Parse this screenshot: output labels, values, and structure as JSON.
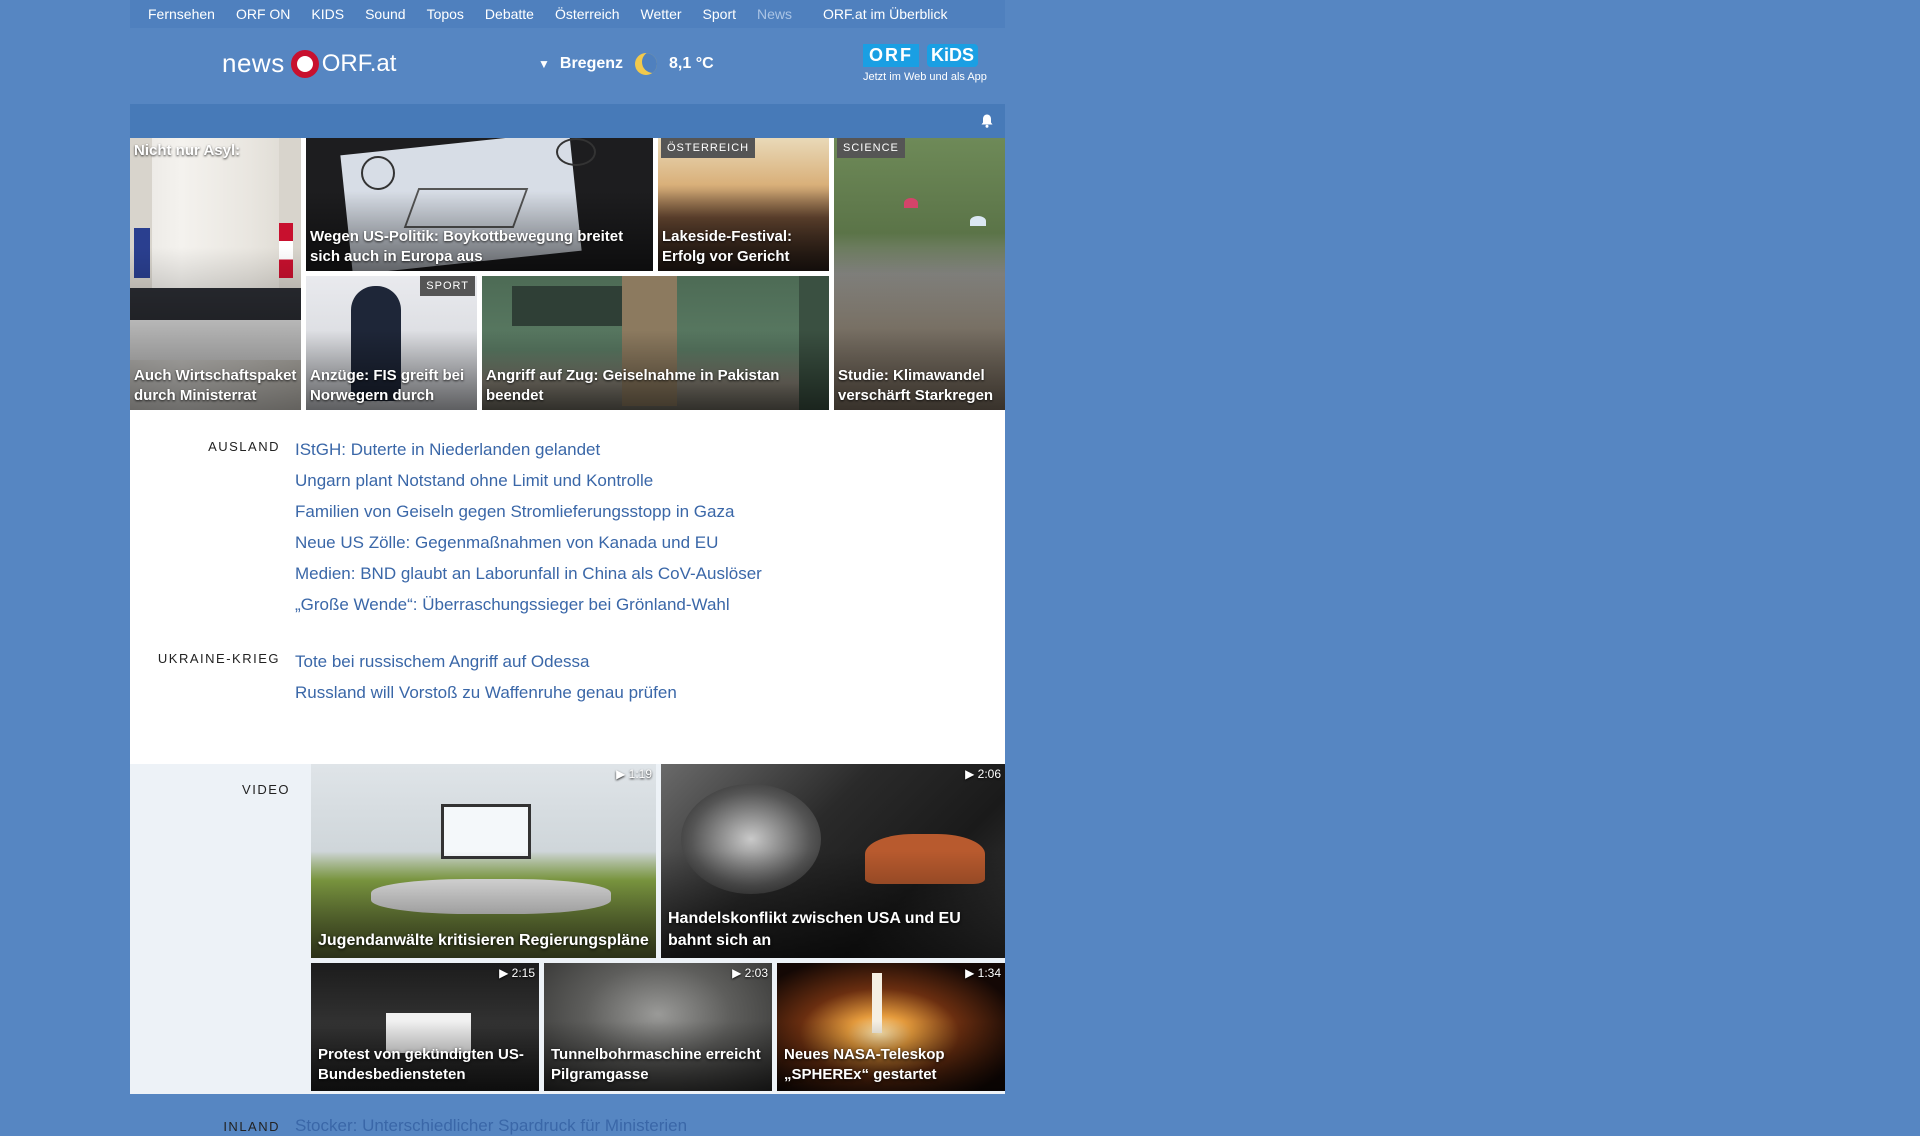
{
  "nav": {
    "items": [
      "Fernsehen",
      "ORF ON",
      "KIDS",
      "Sound",
      "Topos",
      "Debatte",
      "Österreich",
      "Wetter",
      "Sport",
      "News"
    ],
    "overview": "ORF.at im Überblick"
  },
  "header": {
    "logo_news": "news",
    "logo_orf": "ORF.at",
    "city": "Bregenz",
    "temp": "8,1 °C",
    "kids_orf": "ORF",
    "kids_kids": "KiDS",
    "kids_tagline": "Jetzt im Web und als App"
  },
  "teasers": [
    {
      "top_label": "Nicht nur Asyl:",
      "caption": "Auch Wirtschaftspaket durch Ministerrat"
    },
    {
      "caption": "Wegen US-Politik: Boykottbewegung breitet sich auch in Europa aus"
    },
    {
      "badge": "ÖSTERREICH",
      "caption": "Lakeside-Festival: Erfolg vor Gericht"
    },
    {
      "badge": "SCIENCE",
      "caption": "Studie: Klimawandel verschärft Starkregen"
    },
    {
      "badge": "SPORT",
      "caption": "Anzüge: FIS greift bei Norwegern durch"
    },
    {
      "caption": "Angriff auf Zug: Geiselnahme in Pakistan beendet"
    }
  ],
  "sections": [
    {
      "label": "AUSLAND",
      "items": [
        "IStGH: Duterte in Niederlanden gelandet",
        "Ungarn plant Notstand ohne Limit und Kontrolle",
        "Familien von Geiseln gegen Stromlieferungsstopp in Gaza",
        "Neue US Zölle: Gegenmaßnahmen von Kanada und EU",
        "Medien: BND glaubt an Laborunfall in China als CoV-Auslöser",
        "„Große Wende“: Überraschungssieger bei Grönland-Wahl"
      ]
    },
    {
      "label": "UKRAINE-KRIEG",
      "items": [
        "Tote bei russischem Angriff auf Odessa",
        "Russland will Vorstoß zu Waffenruhe genau prüfen"
      ]
    }
  ],
  "video": {
    "label": "VIDEO",
    "items": [
      {
        "duration": "▶ 1:19",
        "caption": "Jugendanwälte kritisieren Regierungspläne"
      },
      {
        "duration": "▶ 2:06",
        "caption": "Handelskonflikt zwischen USA und EU bahnt sich an"
      },
      {
        "duration": "▶ 2:15",
        "caption": "Protest von gekündigten US-Bundesbediensteten"
      },
      {
        "duration": "▶ 2:03",
        "caption": "Tunnelbohrmaschine erreicht Pilgramgasse"
      },
      {
        "duration": "▶ 1:34",
        "caption": "Neues NASA-Teleskop „SPHEREx“ gestartet"
      }
    ]
  },
  "inland": {
    "label": "INLAND",
    "item": "Stocker: Unterschiedlicher Spardruck für Ministerien"
  }
}
